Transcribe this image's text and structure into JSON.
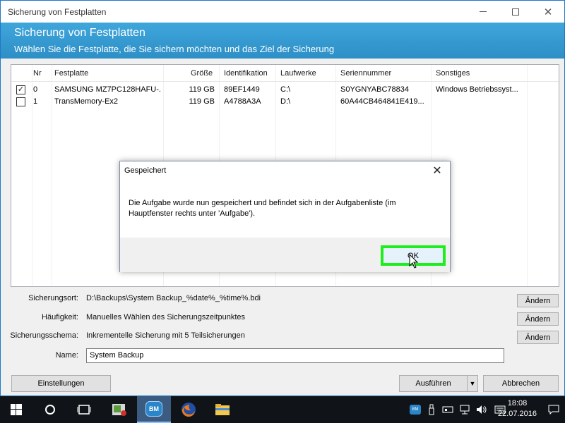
{
  "window": {
    "title": "Sicherung von Festplatten",
    "header_title": "Sicherung von Festplatten",
    "header_subtitle": "Wählen Sie die Festplatte, die Sie sichern möchten und das Ziel der Sicherung"
  },
  "table": {
    "columns": [
      "Nr",
      "Festplatte",
      "Größe",
      "Identifikation",
      "Laufwerke",
      "Seriennummer",
      "Sonstiges"
    ],
    "rows": [
      {
        "checked": true,
        "nr": "0",
        "disk": "SAMSUNG MZ7PC128HAFU-...",
        "size": "119 GB",
        "id": "89EF1449",
        "drive": "C:\\",
        "serial": "S0YGNYABC78834",
        "other": "Windows Betriebssyst..."
      },
      {
        "checked": false,
        "nr": "1",
        "disk": "TransMemory-Ex2",
        "size": "119 GB",
        "id": "A4788A3A",
        "drive": "D:\\",
        "serial": "60A44CB464841E419...",
        "other": ""
      }
    ]
  },
  "settings": {
    "location_label": "Sicherungsort:",
    "location_value": "D:\\Backups\\System Backup_%date%_%time%.bdi",
    "frequency_label": "Häufigkeit:",
    "frequency_value": "Manuelles Wählen des Sicherungszeitpunktes",
    "scheme_label": "Sicherungsschema:",
    "scheme_value": "Inkrementelle Sicherung mit 5 Teilsicherungen",
    "name_label": "Name:",
    "name_value": "System Backup",
    "change_label": "Ändern"
  },
  "footer": {
    "settings_label": "Einstellungen",
    "run_label": "Ausführen",
    "cancel_label": "Abbrechen"
  },
  "dialog": {
    "title": "Gespeichert",
    "message": "Die Aufgabe wurde nun gespeichert und befindet sich in der Aufgabenliste (im Hauptfenster rechts unter 'Aufgabe').",
    "ok_label": "OK",
    "highlight_color": "#1eee1e"
  },
  "taskbar": {
    "time": "18:08",
    "date": "22.07.2016",
    "app_badge": "BM"
  }
}
